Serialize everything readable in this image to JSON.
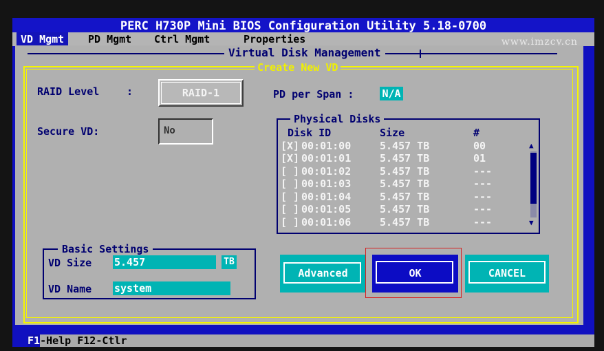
{
  "title": "PERC H730P Mini BIOS Configuration Utility 5.18-0700",
  "tabs": [
    "VD Mgmt",
    "PD Mgmt",
    "Ctrl Mgmt",
    "Properties"
  ],
  "active_tab": "VD Mgmt",
  "watermark": "www.imzcy.cn",
  "panel_title": "Virtual Disk Management",
  "dialog_title": "Create New VD",
  "raid_level": {
    "label": "RAID Level",
    "colon": ":",
    "value": "RAID-1"
  },
  "secure_vd": {
    "label": "Secure VD:",
    "value": "No"
  },
  "pd_per_span": {
    "label": "PD per Span :",
    "value": "N/A"
  },
  "physical_disks": {
    "title": "Physical Disks",
    "headers": {
      "disk_id": "Disk ID",
      "size": "Size",
      "num": "#"
    },
    "rows": [
      {
        "check": "[X]",
        "id": "00:01:00",
        "size": "5.457 TB",
        "num": "00"
      },
      {
        "check": "[X]",
        "id": "00:01:01",
        "size": "5.457 TB",
        "num": "01"
      },
      {
        "check": "[ ]",
        "id": "00:01:02",
        "size": "5.457 TB",
        "num": "---"
      },
      {
        "check": "[ ]",
        "id": "00:01:03",
        "size": "5.457 TB",
        "num": "---"
      },
      {
        "check": "[ ]",
        "id": "00:01:04",
        "size": "5.457 TB",
        "num": "---"
      },
      {
        "check": "[ ]",
        "id": "00:01:05",
        "size": "5.457 TB",
        "num": "---"
      },
      {
        "check": "[ ]",
        "id": "00:01:06",
        "size": "5.457 TB",
        "num": "---"
      }
    ],
    "scroll_up": "▲",
    "scroll_down": "▼"
  },
  "basic_settings": {
    "title": "Basic Settings",
    "vd_size_label": "VD Size",
    "vd_size_value": "5.457",
    "vd_size_unit": "TB",
    "vd_name_label": "VD Name",
    "vd_name_value": "system"
  },
  "buttons": {
    "advanced": "Advanced",
    "ok": "OK",
    "cancel": "CANCEL"
  },
  "statusbar": {
    "key1": "F1",
    "text": "-Help F12-Ctlr"
  },
  "colors": {
    "bios_blue": "#1010c0",
    "panel_gray": "#b0b0b0",
    "yellow": "#f5f500",
    "cyan": "#00b4b4",
    "text_navy": "#000070"
  }
}
